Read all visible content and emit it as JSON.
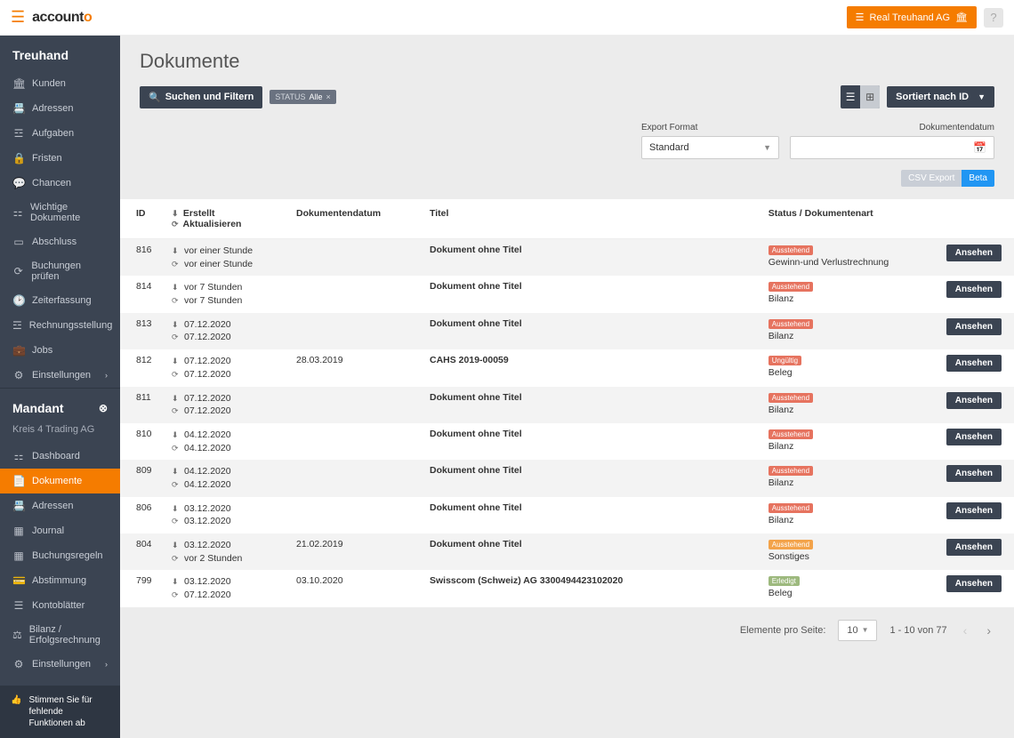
{
  "topbar": {
    "logo_main": "account",
    "logo_accent": "o",
    "company_button": "Real Treuhand AG"
  },
  "sidebar": {
    "section1_title": "Treuhand",
    "section1_items": [
      {
        "icon": "🏛",
        "label": "Kunden"
      },
      {
        "icon": "📇",
        "label": "Adressen"
      },
      {
        "icon": "☲",
        "label": "Aufgaben"
      },
      {
        "icon": "🔒",
        "label": "Fristen"
      },
      {
        "icon": "💬",
        "label": "Chancen"
      },
      {
        "icon": "⚏",
        "label": "Wichtige Dokumente"
      },
      {
        "icon": "▭",
        "label": "Abschluss"
      },
      {
        "icon": "⟳",
        "label": "Buchungen prüfen"
      },
      {
        "icon": "🕑",
        "label": "Zeiterfassung"
      },
      {
        "icon": "☲",
        "label": "Rechnungsstellung"
      },
      {
        "icon": "💼",
        "label": "Jobs"
      },
      {
        "icon": "⚙",
        "label": "Einstellungen",
        "chevron": true
      }
    ],
    "section2_title": "Mandant",
    "section2_sub": "Kreis 4 Trading AG",
    "section2_items": [
      {
        "icon": "⚏",
        "label": "Dashboard"
      },
      {
        "icon": "📄",
        "label": "Dokumente",
        "active": true
      },
      {
        "icon": "📇",
        "label": "Adressen"
      },
      {
        "icon": "▦",
        "label": "Journal"
      },
      {
        "icon": "▦",
        "label": "Buchungsregeln"
      },
      {
        "icon": "💳",
        "label": "Abstimmung"
      },
      {
        "icon": "☰",
        "label": "Kontoblätter"
      },
      {
        "icon": "⚖",
        "label": "Bilanz / Erfolgsrechnung"
      },
      {
        "icon": "⚙",
        "label": "Einstellungen",
        "chevron": true
      }
    ],
    "feedback": "Stimmen Sie für fehlende Funktionen ab"
  },
  "page": {
    "title": "Dokumente",
    "search_filter": "Suchen und Filtern",
    "chip_label": "STATUS",
    "chip_value": "Alle",
    "sort_label": "Sortiert nach ID",
    "export_format_label": "Export Format",
    "export_format_value": "Standard",
    "doc_date_label": "Dokumentendatum",
    "csv_export": "CSV Export",
    "beta": "Beta"
  },
  "table": {
    "headers": {
      "id": "ID",
      "created": "Erstellt",
      "updated": "Aktualisieren",
      "doc_date": "Dokumentendatum",
      "title": "Titel",
      "status": "Status / Dokumentenart"
    },
    "view_btn": "Ansehen",
    "rows": [
      {
        "id": "816",
        "created": "vor einer Stunde",
        "updated": "vor einer Stunde",
        "doc_date": "",
        "title": "Dokument ohne Titel",
        "badge": "Ausstehend",
        "badge_class": "red",
        "type": "Gewinn-und Verlustrechnung"
      },
      {
        "id": "814",
        "created": "vor 7 Stunden",
        "updated": "vor 7 Stunden",
        "doc_date": "",
        "title": "Dokument ohne Titel",
        "badge": "Ausstehend",
        "badge_class": "red",
        "type": "Bilanz"
      },
      {
        "id": "813",
        "created": "07.12.2020",
        "updated": "07.12.2020",
        "doc_date": "",
        "title": "Dokument ohne Titel",
        "badge": "Ausstehend",
        "badge_class": "red",
        "type": "Bilanz"
      },
      {
        "id": "812",
        "created": "07.12.2020",
        "updated": "07.12.2020",
        "doc_date": "28.03.2019",
        "title": "CAHS 2019-00059",
        "badge": "Ungültig",
        "badge_class": "red",
        "type": "Beleg"
      },
      {
        "id": "811",
        "created": "07.12.2020",
        "updated": "07.12.2020",
        "doc_date": "",
        "title": "Dokument ohne Titel",
        "badge": "Ausstehend",
        "badge_class": "red",
        "type": "Bilanz"
      },
      {
        "id": "810",
        "created": "04.12.2020",
        "updated": "04.12.2020",
        "doc_date": "",
        "title": "Dokument ohne Titel",
        "badge": "Ausstehend",
        "badge_class": "red",
        "type": "Bilanz"
      },
      {
        "id": "809",
        "created": "04.12.2020",
        "updated": "04.12.2020",
        "doc_date": "",
        "title": "Dokument ohne Titel",
        "badge": "Ausstehend",
        "badge_class": "red",
        "type": "Bilanz"
      },
      {
        "id": "806",
        "created": "03.12.2020",
        "updated": "03.12.2020",
        "doc_date": "",
        "title": "Dokument ohne Titel",
        "badge": "Ausstehend",
        "badge_class": "red",
        "type": "Bilanz"
      },
      {
        "id": "804",
        "created": "03.12.2020",
        "updated": "vor 2 Stunden",
        "doc_date": "21.02.2019",
        "title": "Dokument ohne Titel",
        "badge": "Ausstehend",
        "badge_class": "orange",
        "type": "Sonstiges"
      },
      {
        "id": "799",
        "created": "03.12.2020",
        "updated": "07.12.2020",
        "doc_date": "03.10.2020",
        "title": "Swisscom (Schweiz) AG 3300494423102020",
        "badge": "Erledigt",
        "badge_class": "green",
        "type": "Beleg"
      }
    ]
  },
  "pager": {
    "per_page_label": "Elemente pro Seite:",
    "per_page_value": "10",
    "range": "1 - 10 von 77"
  }
}
